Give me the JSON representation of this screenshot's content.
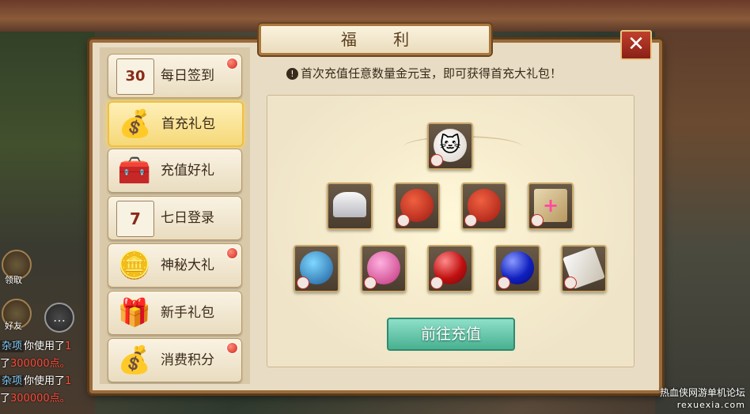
{
  "window": {
    "title": "福 利",
    "close_glyph": "✕"
  },
  "menu": {
    "items": [
      {
        "label": "每日签到",
        "icon": "calendar-30-icon",
        "glyph": "30",
        "badge": true,
        "active": false
      },
      {
        "label": "首充礼包",
        "icon": "gold-bag-icon",
        "glyph": "💰",
        "badge": false,
        "active": true
      },
      {
        "label": "充值好礼",
        "icon": "treasure-chest-icon",
        "glyph": "🧰",
        "badge": false,
        "active": false
      },
      {
        "label": "七日登录",
        "icon": "calendar-7-icon",
        "glyph": "7",
        "badge": false,
        "active": false
      },
      {
        "label": "神秘大礼",
        "icon": "gold-chest-icon",
        "glyph": "🪙",
        "badge": true,
        "active": false
      },
      {
        "label": "新手礼包",
        "icon": "gift-box-icon",
        "glyph": "🎁",
        "badge": false,
        "active": false
      },
      {
        "label": "消费积分",
        "icon": "gold-coins-icon",
        "glyph": "💰",
        "badge": true,
        "active": false
      }
    ]
  },
  "notice": {
    "icon": "exclamation-icon",
    "glyph": "!",
    "text": "首次充值任意数量金元宝，即可获得首充大礼包！"
  },
  "rewards": {
    "row1": [
      {
        "name": "white-cat-pet-icon",
        "glyph": "🐱"
      }
    ],
    "row2": [
      {
        "name": "silver-ingot-icon",
        "glyph": ""
      },
      {
        "name": "red-money-bag-icon",
        "glyph": ""
      },
      {
        "name": "red-money-bag-icon",
        "glyph": ""
      },
      {
        "name": "scroll-plus-pet-icon",
        "glyph": "+"
      }
    ],
    "row3": [
      {
        "name": "blue-gem-icon",
        "glyph": ""
      },
      {
        "name": "pink-crystals-icon",
        "glyph": ""
      },
      {
        "name": "red-orb-icon",
        "glyph": ""
      },
      {
        "name": "blue-orb-icon",
        "glyph": ""
      },
      {
        "name": "scroll-paper-icon",
        "glyph": ""
      }
    ]
  },
  "recharge_button": {
    "label": "前往充值"
  },
  "hud": {
    "receive_label": "领取",
    "friends_label": "好友",
    "chat_glyph": "…",
    "chat_lines": [
      {
        "tag": "杂项",
        "text": "你使用了",
        "tail": "1"
      },
      {
        "tag": "",
        "text": "了",
        "tail": "300000点。"
      },
      {
        "tag": "杂项",
        "text": "你使用了",
        "tail": "1"
      },
      {
        "tag": "",
        "text": "了",
        "tail": "300000点。"
      }
    ]
  },
  "watermark": {
    "line1": "热血侠网游单机论坛",
    "line2": "rexuexia.com"
  },
  "colors": {
    "accent_gold": "#f0c040",
    "badge_red": "#d02a18",
    "button_teal": "#48b090",
    "frame_brown": "#9a6a3a"
  }
}
